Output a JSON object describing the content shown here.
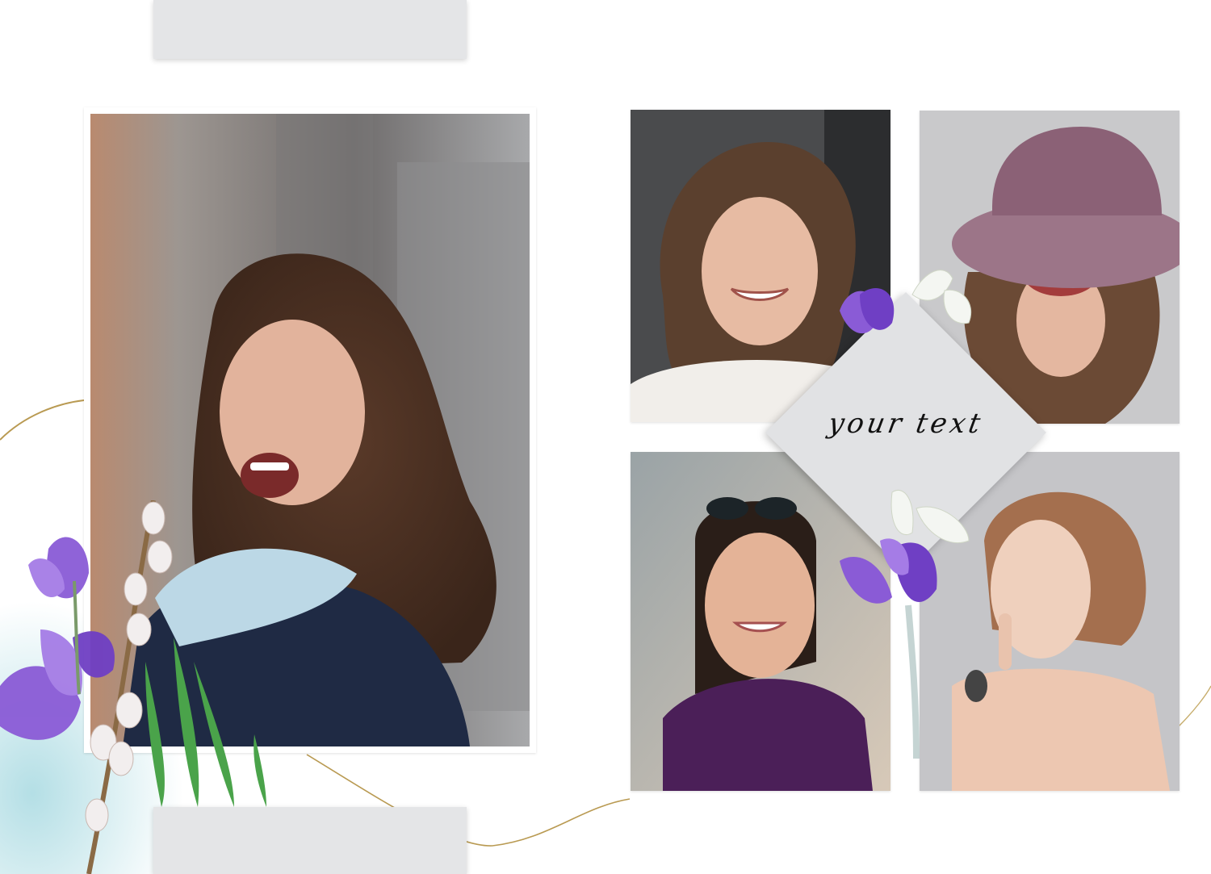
{
  "diamond": {
    "text": "your text"
  },
  "photos": [
    {
      "icon": "laughing-woman-scarf-photo"
    },
    {
      "icon": "smiling-woman-curly-hair-photo"
    },
    {
      "icon": "woman-purple-hat-photo"
    },
    {
      "icon": "woman-sunglasses-purple-top-photo"
    },
    {
      "icon": "redhead-woman-finger-lips-photo"
    }
  ],
  "colors": {
    "placeholder": "#e4e5e7",
    "diamond": "#e1e2e4",
    "watercolor": "#a3d6de",
    "crocus": "#8a5bd6",
    "gold": "#b99a52"
  }
}
